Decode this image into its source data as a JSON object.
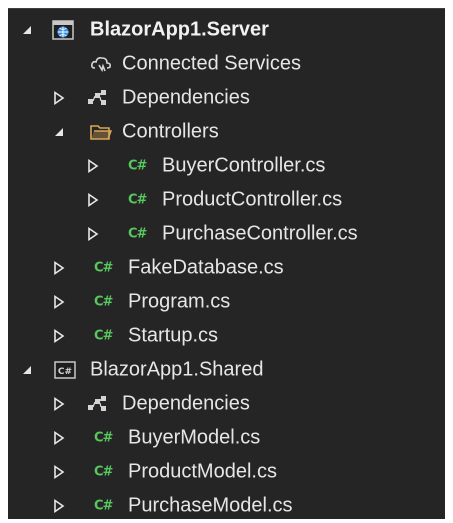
{
  "solution_tree": {
    "items": [
      {
        "label": "BlazorApp1.Server",
        "icon": "web-project-icon",
        "expander": "expanded",
        "bold": true
      },
      {
        "label": "Connected Services",
        "icon": "connected-services-icon",
        "expander": "none"
      },
      {
        "label": "Dependencies",
        "icon": "dependencies-icon",
        "expander": "collapsed"
      },
      {
        "label": "Controllers",
        "icon": "folder-open-icon",
        "expander": "expanded"
      },
      {
        "label": "BuyerController.cs",
        "icon": "csharp-file-icon",
        "expander": "collapsed"
      },
      {
        "label": "ProductController.cs",
        "icon": "csharp-file-icon",
        "expander": "collapsed"
      },
      {
        "label": "PurchaseController.cs",
        "icon": "csharp-file-icon",
        "expander": "collapsed"
      },
      {
        "label": "FakeDatabase.cs",
        "icon": "csharp-file-icon",
        "expander": "collapsed"
      },
      {
        "label": "Program.cs",
        "icon": "csharp-file-icon",
        "expander": "collapsed"
      },
      {
        "label": "Startup.cs",
        "icon": "csharp-file-icon",
        "expander": "collapsed"
      },
      {
        "label": "BlazorApp1.Shared",
        "icon": "csharp-project-icon",
        "expander": "expanded"
      },
      {
        "label": "Dependencies",
        "icon": "dependencies-icon",
        "expander": "collapsed"
      },
      {
        "label": "BuyerModel.cs",
        "icon": "csharp-file-icon",
        "expander": "collapsed"
      },
      {
        "label": "ProductModel.cs",
        "icon": "csharp-file-icon",
        "expander": "collapsed"
      },
      {
        "label": "PurchaseModel.cs",
        "icon": "csharp-file-icon",
        "expander": "collapsed"
      }
    ],
    "csharp_glyph": "C#",
    "colors": {
      "background": "#252526",
      "text": "#e6e6e6",
      "csharp_accent": "#57c75e",
      "folder": "#d8a657",
      "project_blue": "#3c8fe0"
    }
  }
}
